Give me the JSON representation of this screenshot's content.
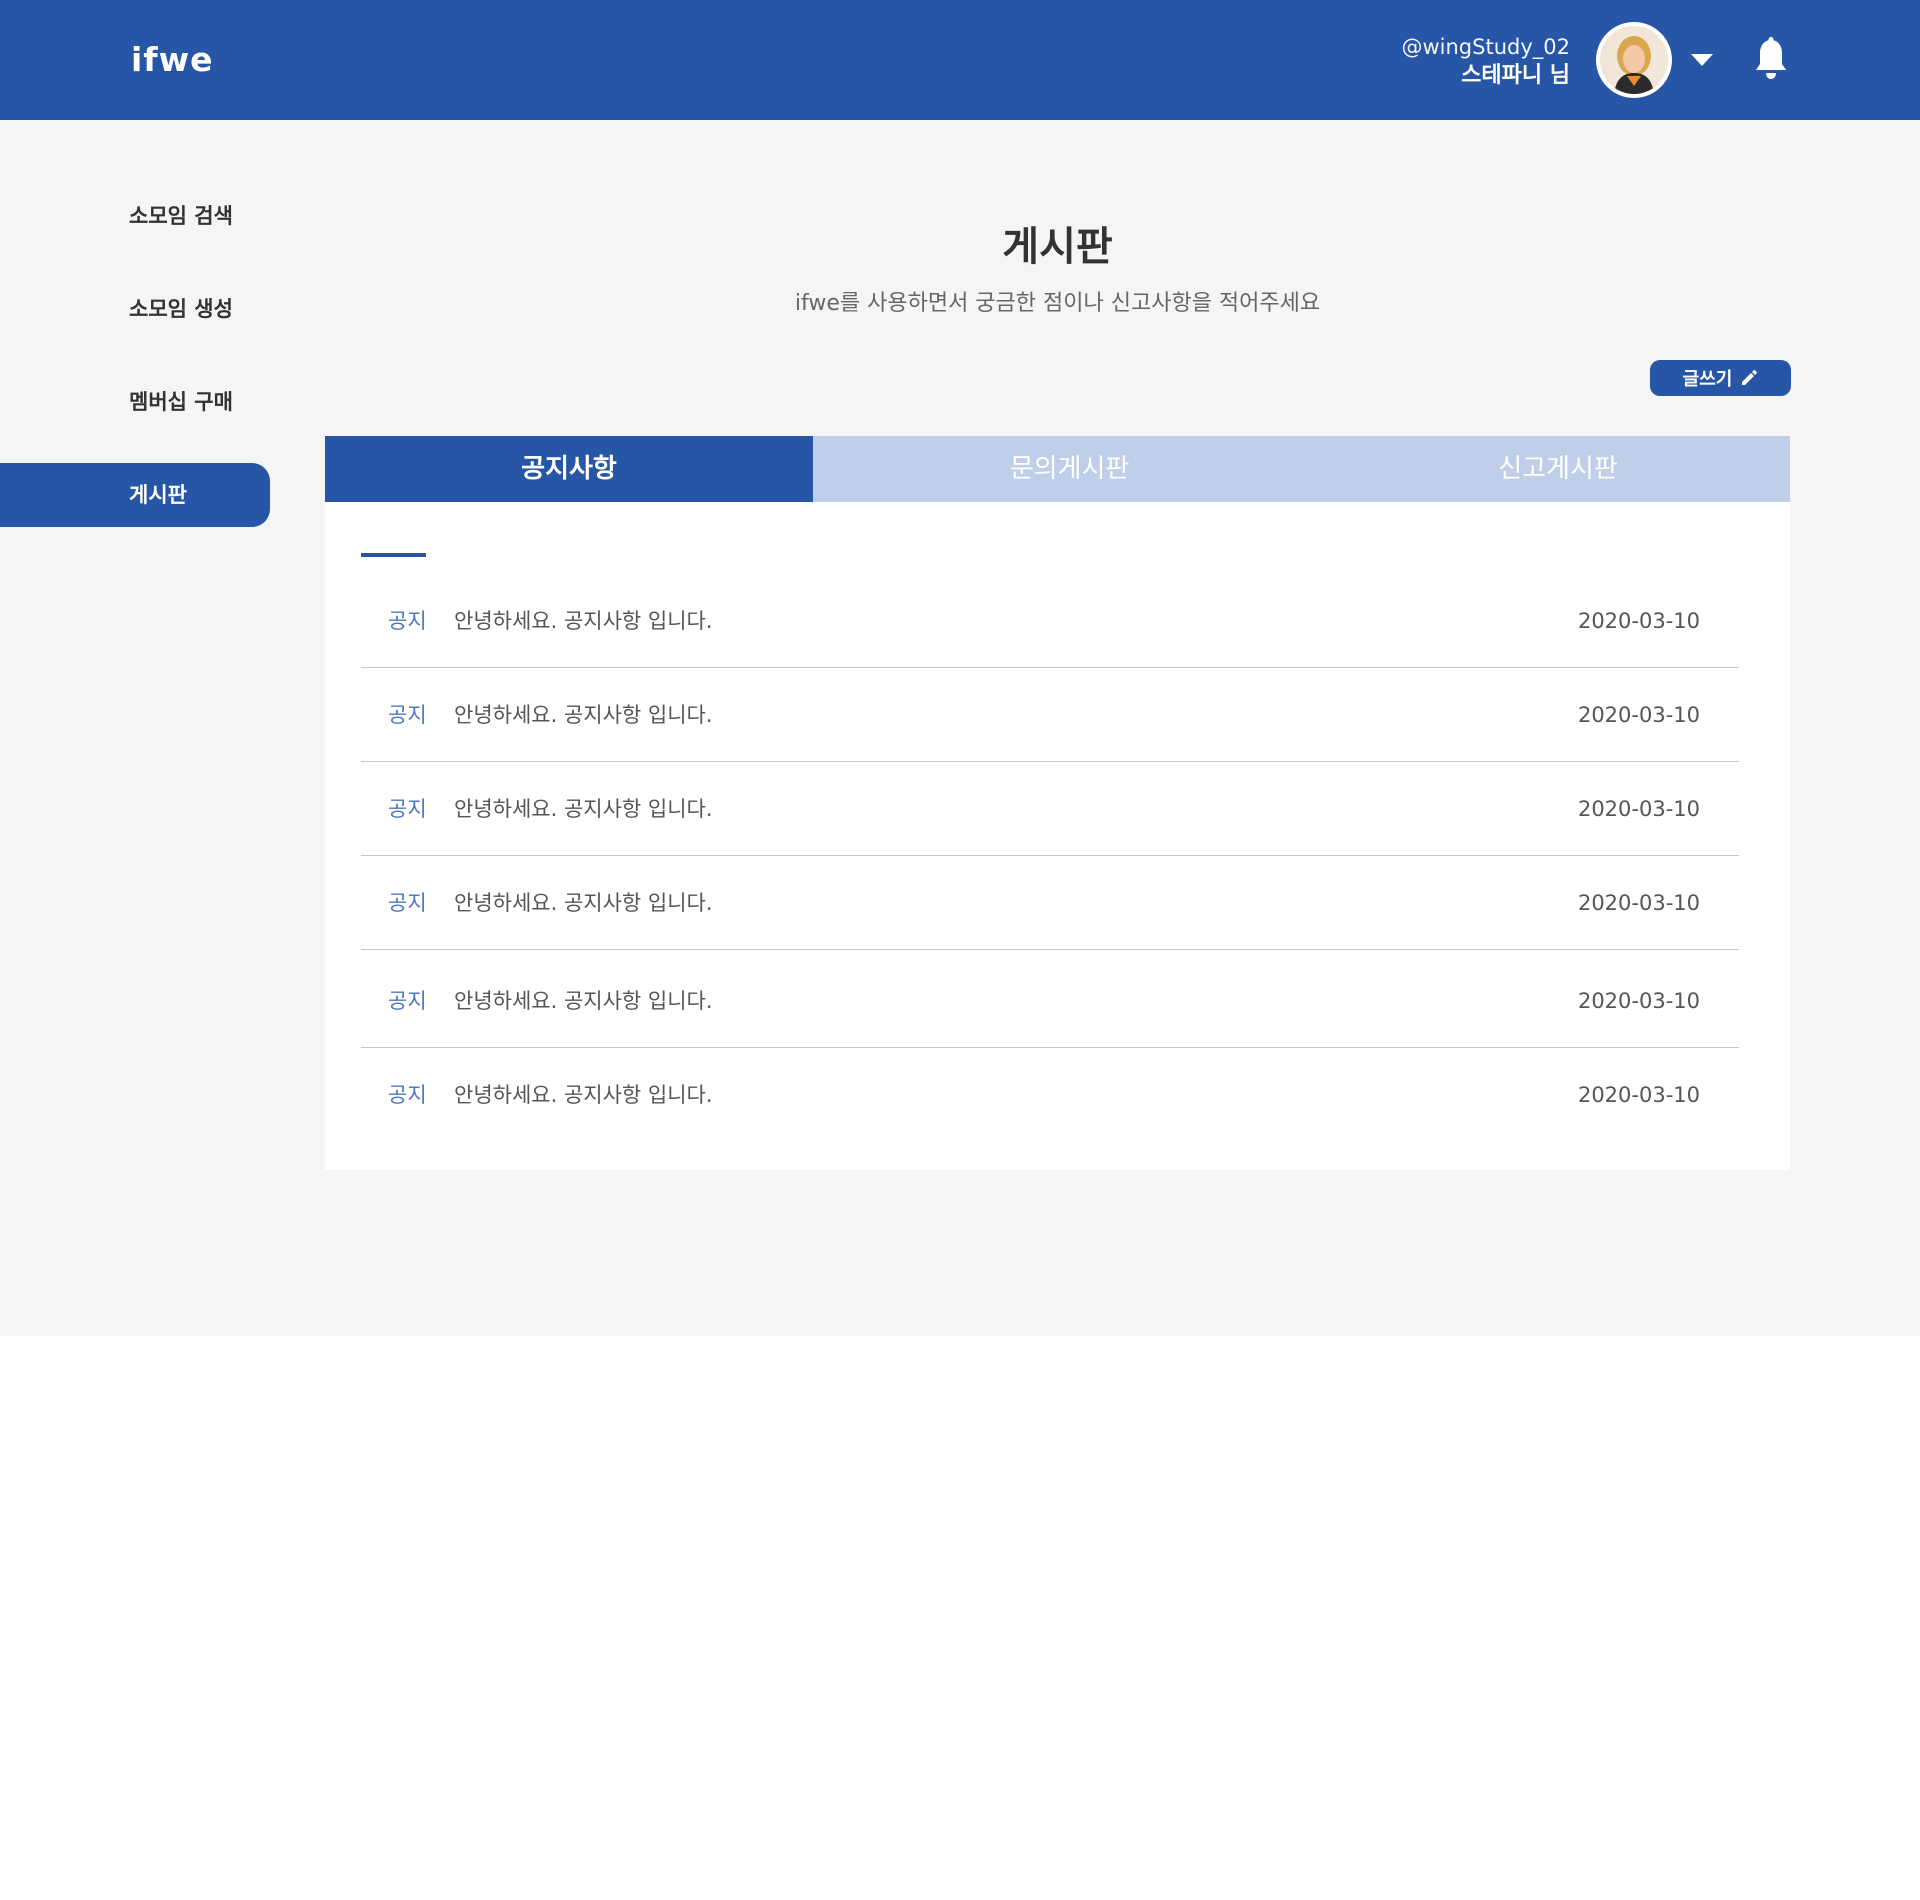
{
  "header": {
    "logo": "ifwe",
    "user_handle": "@wingStudy_02",
    "user_name": "스테파니 님",
    "brand_color": "#2756a6"
  },
  "icons": {
    "dropdown": "chevron-down-icon",
    "notifications": "bell-icon",
    "write": "pencil-icon"
  },
  "sidebar": {
    "items": [
      {
        "label": "소모임 검색",
        "active": false
      },
      {
        "label": "소모임 생성",
        "active": false
      },
      {
        "label": "멤버십 구매",
        "active": false
      },
      {
        "label": "게시판",
        "active": true
      }
    ]
  },
  "main": {
    "title": "게시판",
    "subtitle": "ifwe를 사용하면서 궁금한 점이나 신고사항을 적어주세요",
    "write_button": "글쓰기",
    "tabs": [
      {
        "label": "공지사항",
        "active": true
      },
      {
        "label": "문의게시판",
        "active": false
      },
      {
        "label": "신고게시판",
        "active": false
      }
    ],
    "posts": [
      {
        "tag": "공지",
        "title": "안녕하세요. 공지사항 입니다.",
        "date": "2020-03-10"
      },
      {
        "tag": "공지",
        "title": "안녕하세요. 공지사항 입니다.",
        "date": "2020-03-10"
      },
      {
        "tag": "공지",
        "title": "안녕하세요. 공지사항 입니다.",
        "date": "2020-03-10"
      },
      {
        "tag": "공지",
        "title": "안녕하세요. 공지사항 입니다.",
        "date": "2020-03-10"
      },
      {
        "tag": "공지",
        "title": "안녕하세요. 공지사항 입니다.",
        "date": "2020-03-10"
      },
      {
        "tag": "공지",
        "title": "안녕하세요. 공지사항 입니다.",
        "date": "2020-03-10"
      }
    ]
  }
}
